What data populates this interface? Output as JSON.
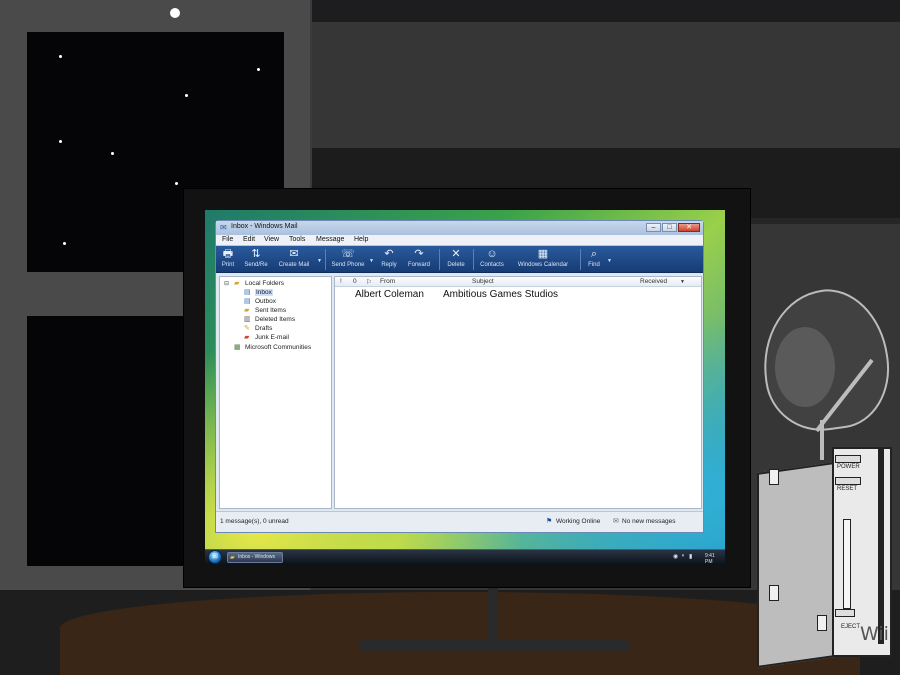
{
  "window": {
    "title": "Inbox - Windows Mail",
    "controls": {
      "minimize": "–",
      "maximize": "□",
      "close": "✕"
    }
  },
  "menu": [
    "File",
    "Edit",
    "View",
    "Tools",
    "Message",
    "Help"
  ],
  "toolbar": [
    {
      "label": "Print",
      "icon": "printer-icon",
      "glyph": "🖶"
    },
    {
      "label": "Send/Re",
      "icon": "send-receive-icon",
      "glyph": "⇅"
    },
    {
      "label": "Create Mail",
      "icon": "create-mail-icon",
      "glyph": "✉"
    },
    {
      "label": "Send Phone",
      "icon": "phone-icon",
      "glyph": "☏"
    },
    {
      "label": "Reply",
      "icon": "reply-icon",
      "glyph": "↶"
    },
    {
      "label": "Forward",
      "icon": "forward-icon",
      "glyph": "↷"
    },
    {
      "label": "Delete",
      "icon": "delete-icon",
      "glyph": "✕"
    },
    {
      "label": "Contacts",
      "icon": "contacts-icon",
      "glyph": "☺"
    },
    {
      "label": "Windows Calendar",
      "icon": "calendar-icon",
      "glyph": "▦"
    },
    {
      "label": "Find",
      "icon": "find-icon",
      "glyph": "⌕"
    }
  ],
  "folders": [
    {
      "label": "Local Folders",
      "indent": 0,
      "selected": false,
      "expander": "⊟"
    },
    {
      "label": "Inbox",
      "indent": 1,
      "selected": true
    },
    {
      "label": "Outbox",
      "indent": 1,
      "selected": false
    },
    {
      "label": "Sent Items",
      "indent": 1,
      "selected": false
    },
    {
      "label": "Deleted Items",
      "indent": 1,
      "selected": false
    },
    {
      "label": "Drafts",
      "indent": 1,
      "selected": false
    },
    {
      "label": "Junk E-mail",
      "indent": 1,
      "selected": false
    },
    {
      "label": "Microsoft Communities",
      "indent": 0,
      "selected": false
    }
  ],
  "message_list": {
    "columns": {
      "flag": "!",
      "attachment": "0",
      "watch": "⚐",
      "from": "From",
      "subject": "Subject",
      "received": "Received"
    },
    "rows": [
      {
        "from": "Albert Coleman",
        "subject": "Ambitious Games Studios"
      }
    ]
  },
  "status": {
    "left": "1 message(s), 0 unread",
    "online": "Working Online",
    "new_messages": "No new messages"
  },
  "taskbar": {
    "start": "⊞",
    "task_label": "Inbox - Windows",
    "clock": "9:41 PM"
  },
  "console": {
    "brand": "Wii",
    "power": "POWER",
    "reset": "RESET",
    "eject": "EJECT"
  }
}
